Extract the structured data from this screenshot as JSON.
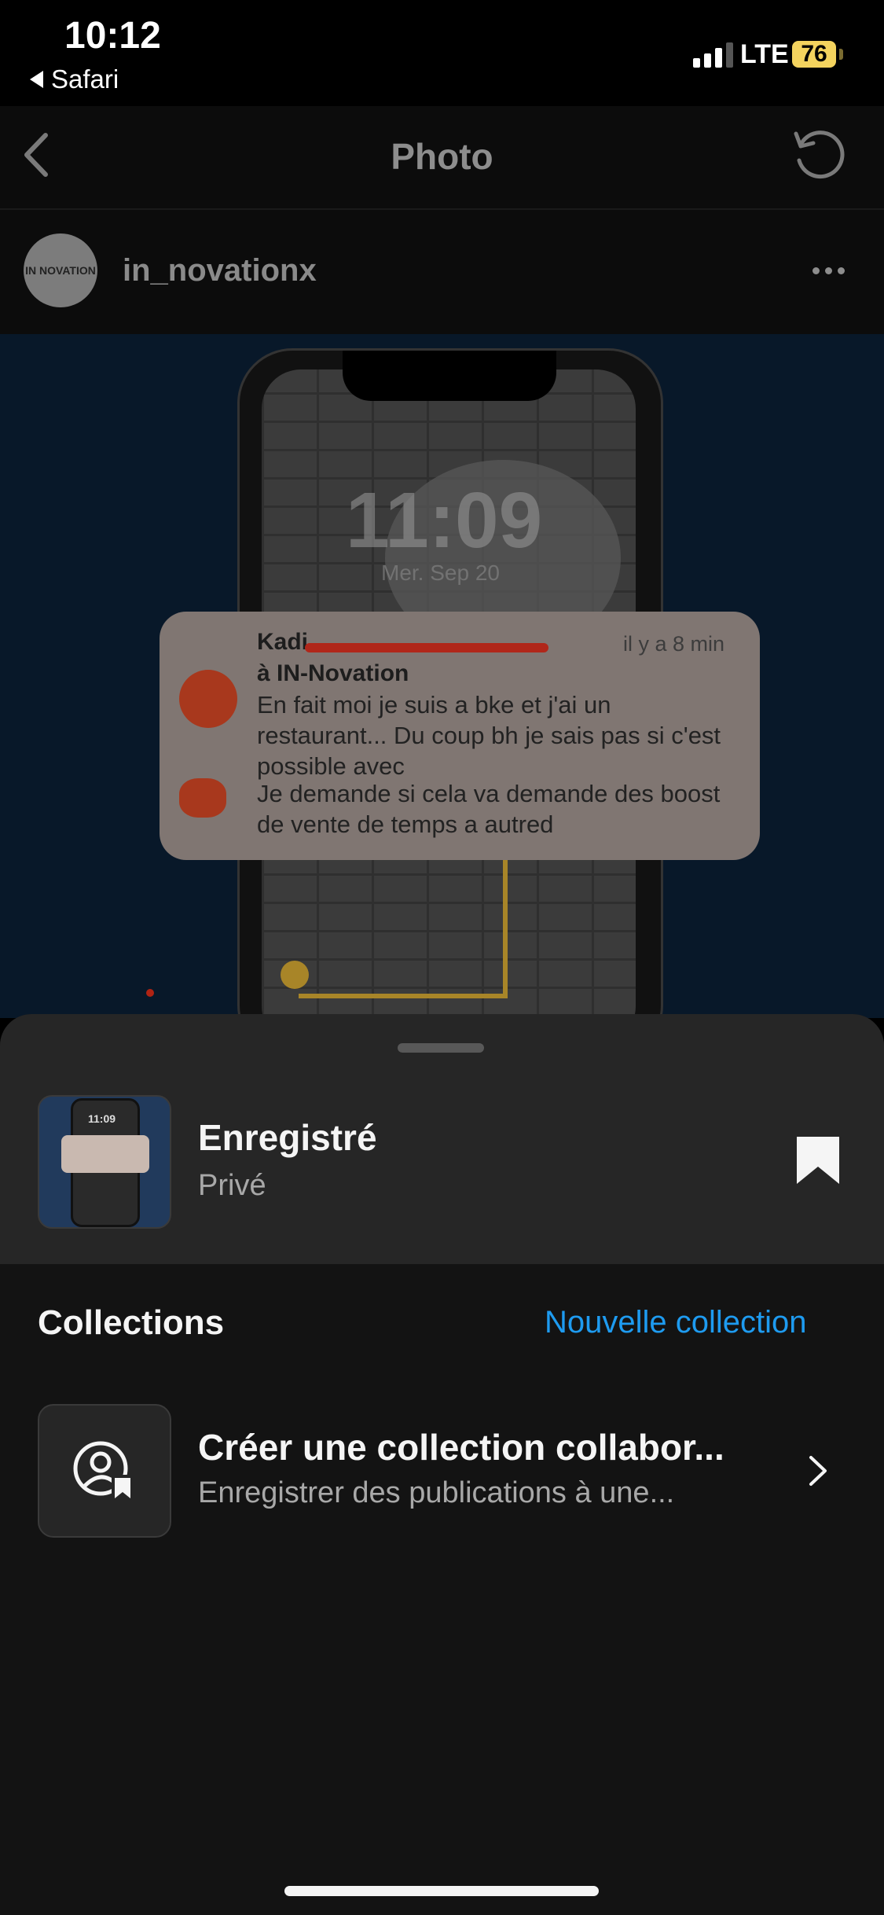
{
  "status_bar": {
    "time": "10:12",
    "back_app": "Safari",
    "network": "LTE",
    "battery": "76"
  },
  "nav": {
    "title": "Photo"
  },
  "post": {
    "username": "in_novationx",
    "avatar_text": "IN NOVATION",
    "image": {
      "lock_time": "11:09",
      "lock_date": "Mer. Sep 20",
      "notification": {
        "sender": "Kadi",
        "time": "il y a 8 min",
        "group": "à IN-Novation",
        "message_1": "En fait moi je suis a bke et j'ai un restaurant... Du coup bh je sais pas si c'est possible avec",
        "message_2": "Je demande si cela va demande des boost de vente de temps a autred"
      }
    }
  },
  "sheet": {
    "saved_title": "Enregistré",
    "saved_subtitle": "Privé",
    "thumb_time": "11:09",
    "collections_heading": "Collections",
    "new_collection_label": "Nouvelle collection",
    "collab_title": "Créer une collection collabor...",
    "collab_subtitle": "Enregistrer des publications à une..."
  },
  "colors": {
    "accent": "#1e9bf0",
    "battery": "#f4d35e",
    "sheet_bg": "#131313",
    "sheet_top_bg": "#262626"
  },
  "icons": {
    "back": "chevron-left-icon",
    "refresh": "refresh-icon",
    "more": "more-horizontal-icon",
    "bookmark": "bookmark-filled-icon",
    "collab": "person-bookmark-icon",
    "chevron": "chevron-right-icon"
  }
}
